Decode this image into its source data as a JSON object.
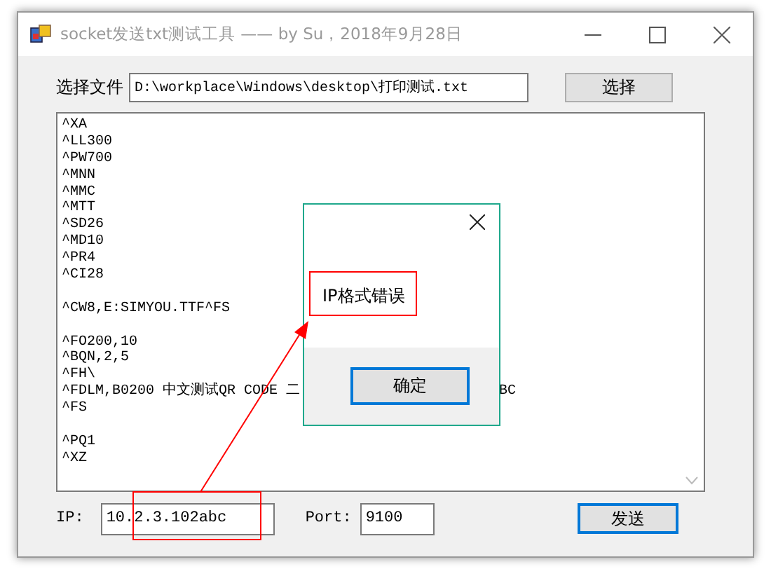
{
  "window": {
    "title": "socket发送txt测试工具 —— by Su，2018年9月28日"
  },
  "file_row": {
    "label": "选择文件",
    "value": "D:\\workplace\\Windows\\desktop\\打印测试.txt",
    "button": "选择"
  },
  "editor": {
    "lines": [
      {
        "kind": "text",
        "text": "^XA"
      },
      {
        "kind": "text",
        "text": "^LL300"
      },
      {
        "kind": "text",
        "text": "^PW700"
      },
      {
        "kind": "text",
        "text": "^MNN"
      },
      {
        "kind": "text",
        "text": "^MMC"
      },
      {
        "kind": "text",
        "text": "^MTT"
      },
      {
        "kind": "text",
        "text": "^SD26"
      },
      {
        "kind": "text",
        "text": "^MD10"
      },
      {
        "kind": "text",
        "text": "^PR4"
      },
      {
        "kind": "text",
        "text": "^CI28"
      },
      {
        "kind": "blank"
      },
      {
        "kind": "text",
        "text": "^CW8,E:SIMYOU.TTF^FS"
      },
      {
        "kind": "blank"
      },
      {
        "kind": "text",
        "text": "^FO200,10"
      },
      {
        "kind": "text",
        "text": "^BQN,2,5"
      },
      {
        "kind": "text",
        "text": "^FH\\"
      },
      {
        "kind": "text",
        "text": "^FDLM,B0200 中文测试QR CODE 二",
        "tail": "BC"
      },
      {
        "kind": "text",
        "text": "^FS"
      },
      {
        "kind": "blank"
      },
      {
        "kind": "text",
        "text": "^PQ1"
      },
      {
        "kind": "text",
        "text": "^XZ"
      }
    ]
  },
  "ip": {
    "label": "IP:",
    "value": "10.2.3.102abc"
  },
  "port": {
    "label": "Port:",
    "value": "9100"
  },
  "send_button": {
    "label": "发送",
    "focused": true
  },
  "dialog": {
    "message": "IP格式错误",
    "button": "确定",
    "button_focused": true
  }
}
